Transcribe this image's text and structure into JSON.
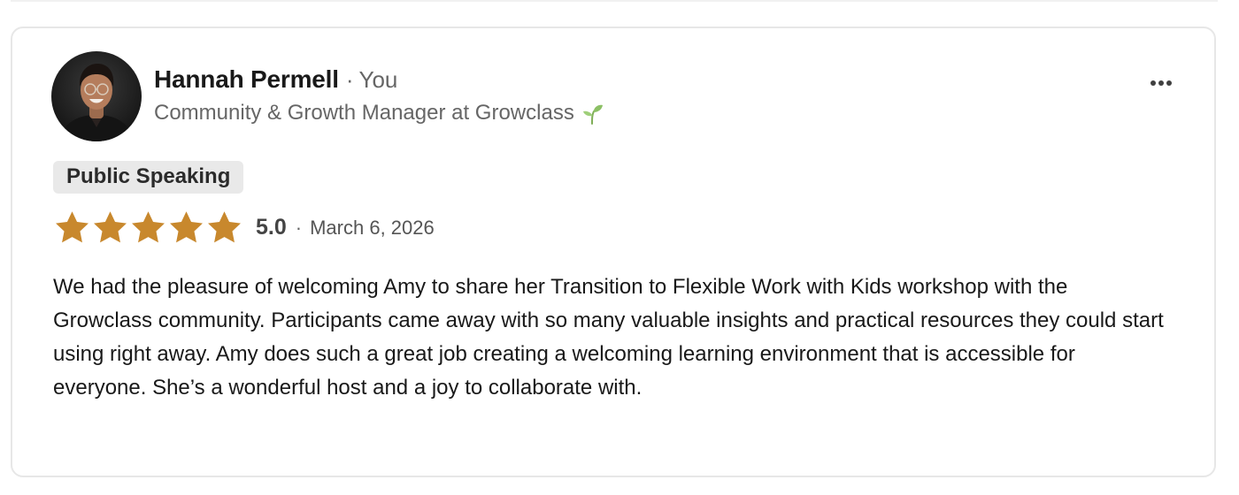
{
  "review": {
    "author": {
      "name": "Hannah Permell",
      "separator": "·",
      "relation": "You",
      "headline": "Community & Growth Manager at Growclass",
      "headline_icon": "sprout-icon",
      "avatar_icon": "avatar-photo"
    },
    "more_options_icon": "ellipsis-icon",
    "skill": "Public Speaking",
    "rating": {
      "stars_filled": 5,
      "stars_total": 5,
      "star_color": "#c8882d",
      "score": "5.0",
      "separator": "·",
      "date": "March 6, 2026"
    },
    "text": "We had the pleasure of welcoming Amy to share her Transition to Flexible Work with Kids workshop with the Growclass community. Participants came away with so many valuable insights and practical resources they could start using right away. Amy does such a great job creating a welcoming learning environment that is accessible for everyone. She’s a wonderful host and a joy to collaborate with."
  },
  "colors": {
    "text_primary": "#191919",
    "text_secondary": "#666666",
    "tag_background": "#e9e9e9",
    "card_border": "#e7e7e7"
  }
}
